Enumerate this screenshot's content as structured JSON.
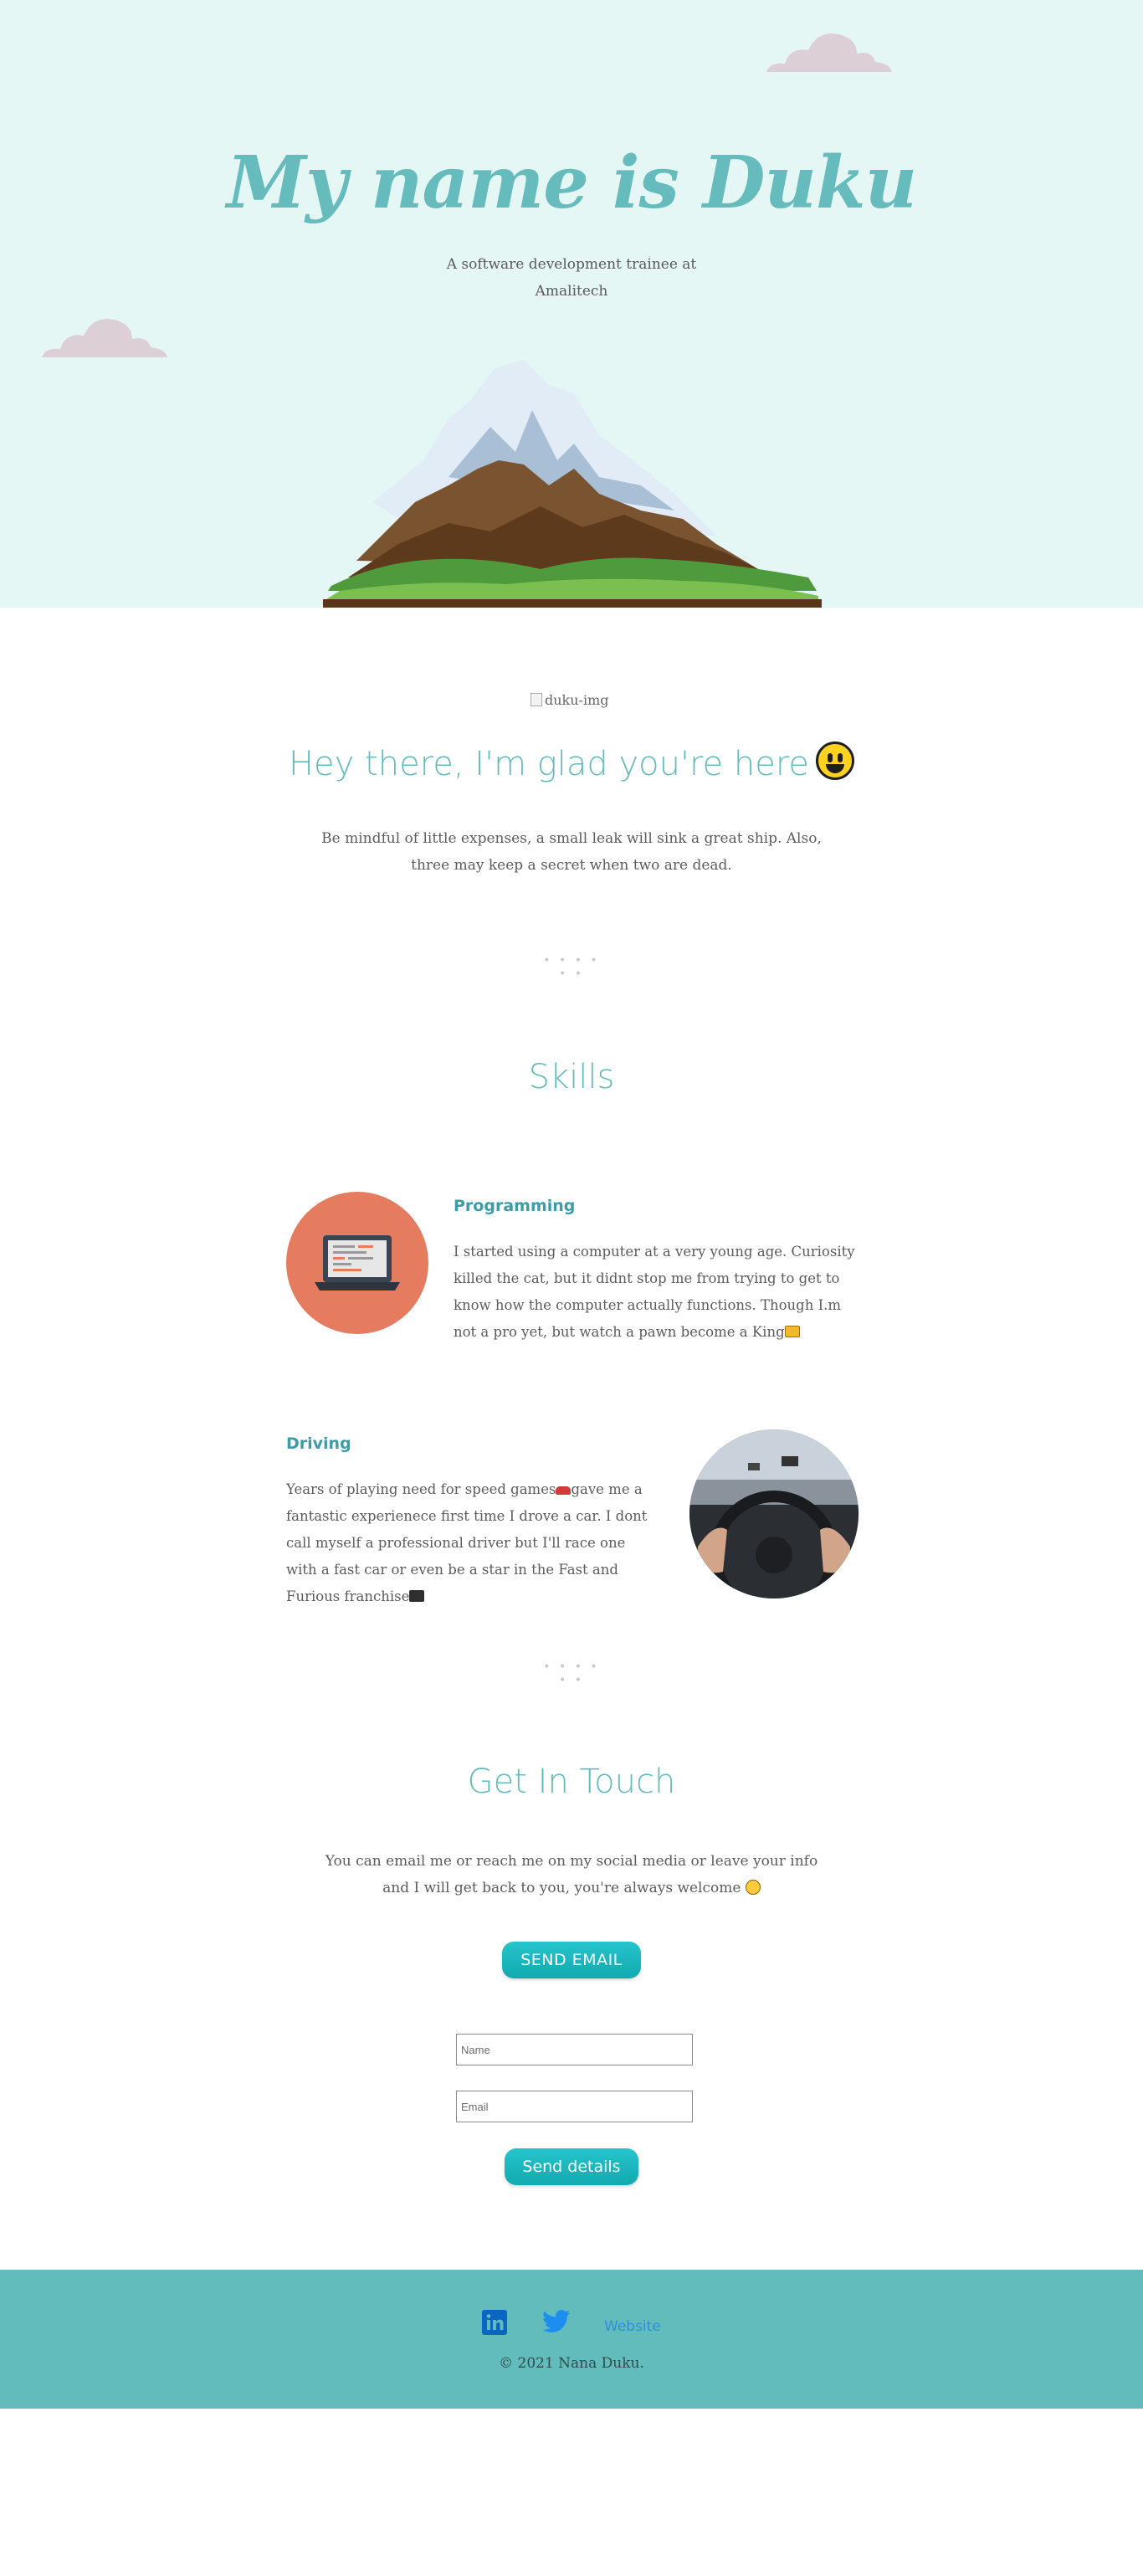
{
  "hero": {
    "title": "My name is Duku",
    "subtitle": "A software development trainee at Amalitech",
    "bg_color": "#e4f7f4",
    "title_color": "#66bcbc"
  },
  "intro": {
    "image_alt": "duku-img",
    "greeting": "Hey there, I'm glad you're here",
    "greeting_emoji": "smiley-face",
    "text": "Be mindful of little expenses, a small leak will sink a great ship. Also, three may keep a secret when two are dead."
  },
  "divider": "• • • • • •",
  "skills": {
    "title": "Skills",
    "items": [
      {
        "heading": "Programming",
        "text": "I started using a computer at a very young age. Curiosity killed the cat, but it didnt stop me from trying to get to know how the computer actually functions. Though I.m not a pro yet, but watch a pawn become a King",
        "image": "laptop-illustration",
        "emoji": "crown"
      },
      {
        "heading": "Driving",
        "text_before": "Years of playing need for speed games",
        "text_after": "gave me a fantastic experienece first time I drove a car. I dont call myself a professional driver but I'll race one with a fast car or even be a star in the Fast and Furious franchise",
        "image": "steering-wheel-photo",
        "emoji_1": "race-car",
        "emoji_2": "movie-camera"
      }
    ]
  },
  "contact": {
    "title": "Get In Touch",
    "text": "You can email me or reach me on my social media or leave your info and I will get back to you, you're always welcome",
    "email_button": "SEND EMAIL",
    "name_placeholder": "Name",
    "email_placeholder": "Email",
    "send_button": "Send details",
    "button_color": "#1bb6bd"
  },
  "footer": {
    "linkedin_icon": "linkedin-icon",
    "twitter_icon": "twitter-icon",
    "website_label": "Website",
    "copyright": "© 2021 Nana Duku.",
    "bg_color": "#63bcbc"
  }
}
